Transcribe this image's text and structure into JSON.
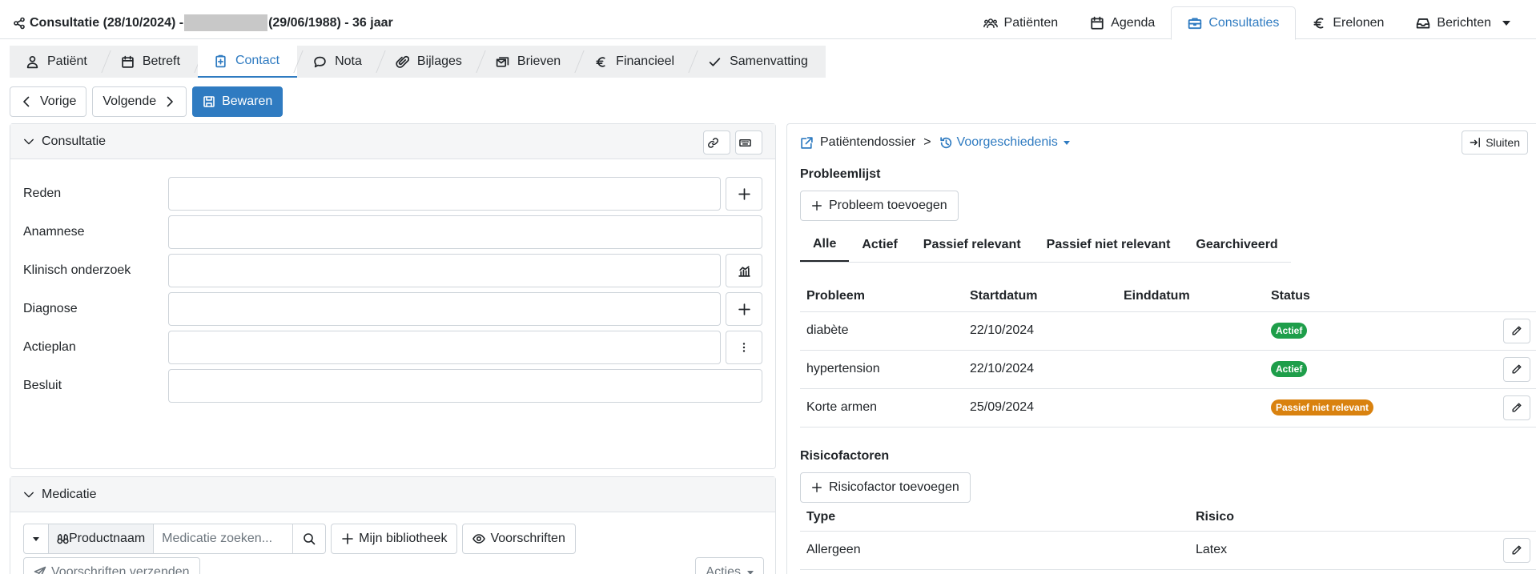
{
  "header": {
    "title_prefix": "Consultatie (28/10/2024) -",
    "title_suffix": "(29/06/1988) - 36 jaar",
    "nav": [
      {
        "label": "Patiënten",
        "icon": "users-icon"
      },
      {
        "label": "Agenda",
        "icon": "calendar-icon"
      },
      {
        "label": "Consultaties",
        "icon": "briefcase-icon",
        "active": true
      },
      {
        "label": "Erelonen",
        "icon": "euro-icon"
      },
      {
        "label": "Berichten",
        "icon": "inbox-icon"
      }
    ]
  },
  "steps": [
    {
      "label": "Patiënt",
      "icon": "person-icon"
    },
    {
      "label": "Betreft",
      "icon": "calendar-icon"
    },
    {
      "label": "Contact",
      "icon": "clipboard-icon",
      "active": true
    },
    {
      "label": "Nota",
      "icon": "chat-icon"
    },
    {
      "label": "Bijlages",
      "icon": "paperclip-icon"
    },
    {
      "label": "Brieven",
      "icon": "letters-icon"
    },
    {
      "label": "Financieel",
      "icon": "euro-icon"
    },
    {
      "label": "Samenvatting",
      "icon": "check-icon"
    }
  ],
  "actions": {
    "prev": "Vorige",
    "next": "Volgende",
    "save": "Bewaren"
  },
  "consultatie": {
    "title": "Consultatie",
    "fields": [
      {
        "label": "Reden",
        "value": "",
        "button": "plus-icon"
      },
      {
        "label": "Anamnese",
        "value": ""
      },
      {
        "label": "Klinisch onderzoek",
        "value": "",
        "button": "chart-icon"
      },
      {
        "label": "Diagnose",
        "value": "",
        "button": "plus-icon"
      },
      {
        "label": "Actieplan",
        "value": "",
        "button": "more-icon"
      },
      {
        "label": "Besluit",
        "value": ""
      }
    ]
  },
  "medicatie": {
    "title": "Medicatie",
    "search_mode": "Productnaam",
    "search_placeholder": "Medicatie zoeken...",
    "library": "Mijn bibliotheek",
    "prescriptions": "Voorschriften",
    "send": "Voorschriften verzenden",
    "acties": "Acties"
  },
  "dossier": {
    "breadcrumb": "Patiëntendossier",
    "separator": ">",
    "section": "Voorgeschiedenis",
    "close": "Sluiten",
    "problems": {
      "title": "Probleemlijst",
      "add": "Probleem toevoegen",
      "tabs": [
        "Alle",
        "Actief",
        "Passief relevant",
        "Passief niet relevant",
        "Gearchiveerd"
      ],
      "columns": [
        "Probleem",
        "Startdatum",
        "Einddatum",
        "Status"
      ],
      "rows": [
        {
          "problem": "diabète",
          "start": "22/10/2024",
          "end": "",
          "status": "Actief",
          "color": "#1e9e4a"
        },
        {
          "problem": "hypertension",
          "start": "22/10/2024",
          "end": "",
          "status": "Actief",
          "color": "#1e9e4a"
        },
        {
          "problem": "Korte armen",
          "start": "25/09/2024",
          "end": "",
          "status": "Passief niet relevant",
          "color": "#d9820f"
        }
      ]
    },
    "risks": {
      "title": "Risicofactoren",
      "add": "Risicofactor toevoegen",
      "columns": [
        "Type",
        "Risico"
      ],
      "rows": [
        {
          "type": "Allergeen",
          "risk": "Latex"
        }
      ]
    }
  }
}
